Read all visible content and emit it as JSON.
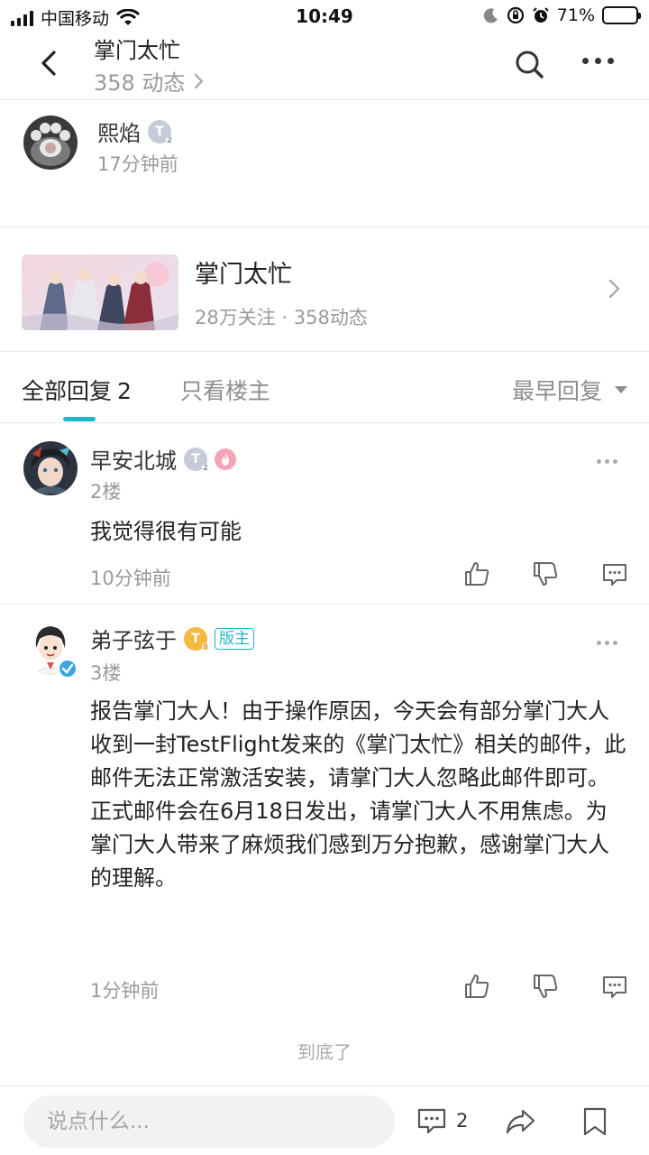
{
  "status_bar": {
    "carrier": "中国移动",
    "time": "10:49",
    "battery_percent": "71%",
    "battery_level": 0.71,
    "icons": [
      "signal-icon",
      "wifi-icon",
      "moon-icon",
      "rotation-lock-icon",
      "alarm-icon",
      "battery-icon"
    ]
  },
  "header": {
    "title": "掌门太忙",
    "subtitle": "358 动态",
    "icons": [
      "back-icon",
      "search-icon",
      "more-icon"
    ]
  },
  "author": {
    "name": "熙焰",
    "level": "T",
    "level_sub": "2",
    "time": "17分钟前"
  },
  "game_card": {
    "name": "掌门太忙",
    "stats": "28万关注 · 358动态"
  },
  "tabs": {
    "all_label": "全部回复",
    "all_count": "2",
    "owner_label": "只看楼主",
    "sort_label": "最早回复"
  },
  "replies": [
    {
      "name": "早安北城",
      "level": "T",
      "level_sub": "2",
      "floor": "2楼",
      "content": "我觉得很有可能",
      "time": "10分钟前"
    },
    {
      "name": "弟子弦于",
      "level": "T",
      "level_sub": "8",
      "mod_tag": "版主",
      "floor": "3楼",
      "content": "报告掌门大人！由于操作原因，今天会有部分掌门大人收到一封TestFlight发来的《掌门太忙》相关的邮件，此邮件无法正常激活安装，请掌门大人忽略此邮件即可。正式邮件会在6月18日发出，请掌门大人不用焦虑。为掌门大人带来了麻烦我们感到万分抱歉，感谢掌门大人的理解。",
      "time": "1分钟前"
    }
  ],
  "end_text": "到底了",
  "bottom_bar": {
    "input_placeholder": "说点什么...",
    "comment_count": "2"
  },
  "colors": {
    "accent": "#1fb8c8",
    "secondary_text": "#9a9a9a",
    "battery": "#4cd964"
  }
}
